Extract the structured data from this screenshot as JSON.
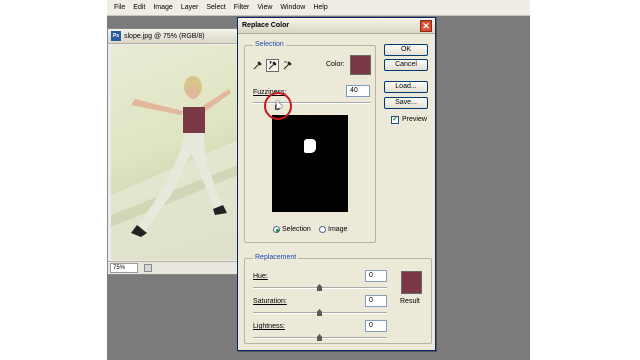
{
  "menubar": {
    "items": [
      "File",
      "Edit",
      "Image",
      "Layer",
      "Select",
      "Filter",
      "View",
      "Window",
      "Help"
    ]
  },
  "document": {
    "title": "slope.jpg @ 75% (RGB/8)",
    "app_icon": "Ps",
    "zoom": "75%"
  },
  "dialog": {
    "title": "Replace Color",
    "close_glyph": "✕",
    "selection": {
      "legend": "Selection",
      "color_label": "Color:",
      "color": "#7a3945",
      "fuzziness_label": "Fuzziness:",
      "fuzziness_value": "40",
      "fuzziness_level": 0.2,
      "radio_selection": "Selection",
      "radio_image": "Image",
      "selected_mode": "Selection",
      "droppers": [
        {
          "name": "eyedropper-icon",
          "glyph": "⚲"
        },
        {
          "name": "eyedropper-plus-icon",
          "glyph": "⚲"
        },
        {
          "name": "eyedropper-minus-icon",
          "glyph": "⚲"
        }
      ]
    },
    "buttons": {
      "ok": "OK",
      "cancel": "Cancel",
      "load": "Load...",
      "save": "Save..."
    },
    "preview_label": "Preview",
    "preview_checked": true,
    "replacement": {
      "legend": "Replacement",
      "hue_label": "Hue:",
      "hue_value": "0",
      "saturation_label": "Saturation:",
      "saturation_value": "0",
      "lightness_label": "Lightness:",
      "lightness_value": "0",
      "result_label": "Result",
      "result_color": "#7a3945"
    }
  }
}
